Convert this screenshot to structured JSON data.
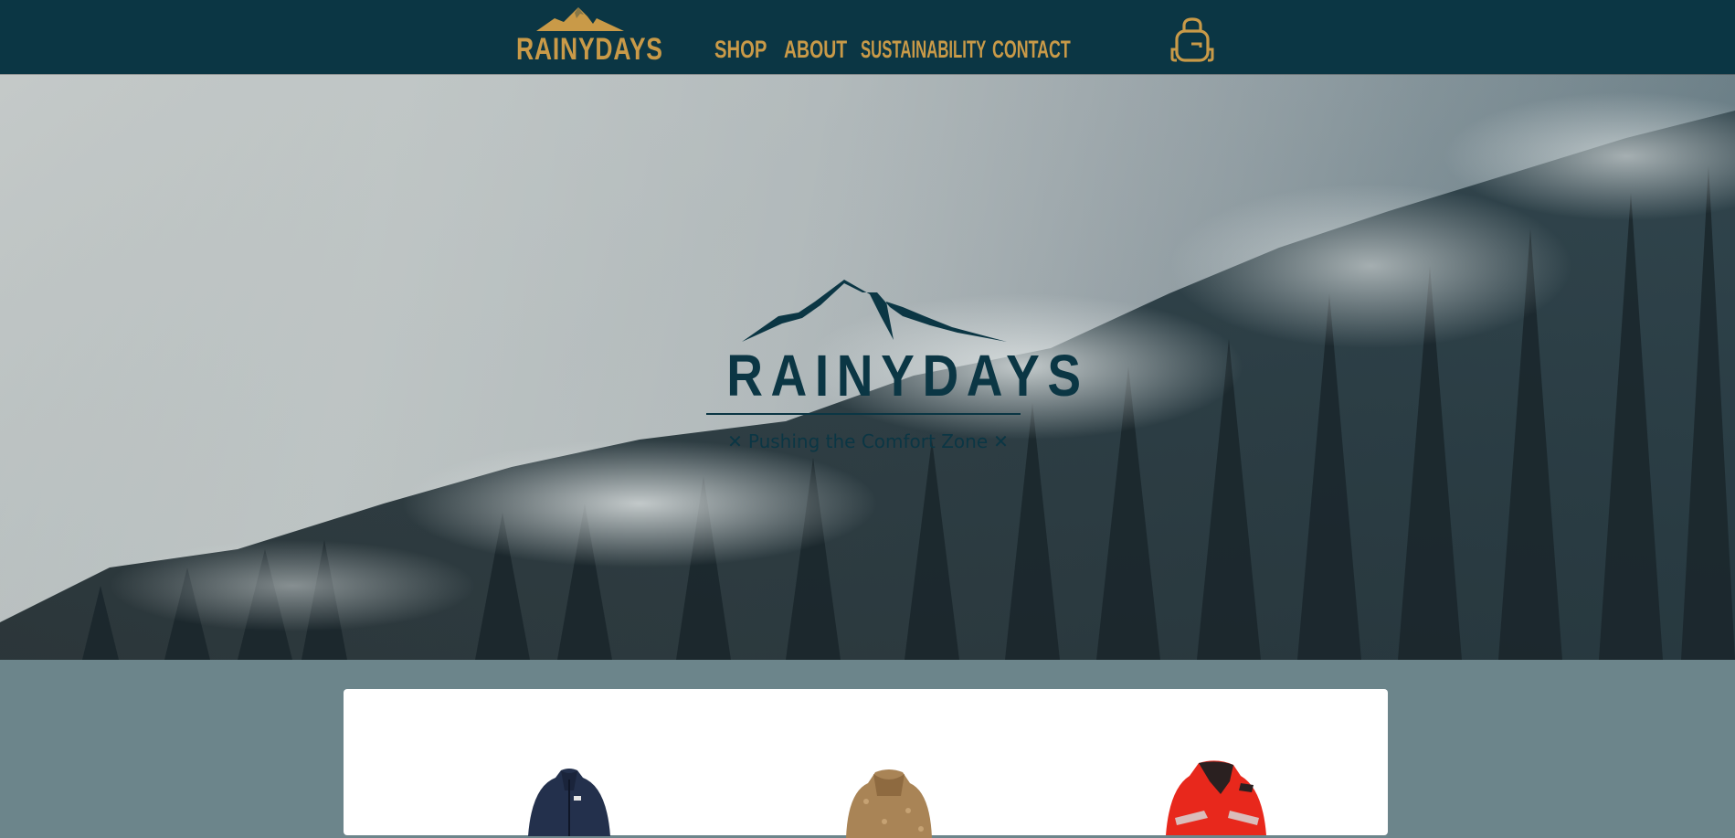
{
  "nav": {
    "logo_text": "RAINYDAYS",
    "links": [
      {
        "label": "SHOP"
      },
      {
        "label": "ABOUT"
      },
      {
        "label": "SUSTAINABILITY"
      },
      {
        "label": "CONTACT"
      }
    ],
    "cart_icon": "backpack-icon"
  },
  "hero": {
    "brand_name": "RAINYDAYS",
    "tagline": "Pushing the Comfort Zone",
    "tagline_icon": "cross-mark-icon"
  },
  "products": [
    {
      "icon": "navy-fleece-jacket-image"
    },
    {
      "icon": "tan-sherpa-jacket-image"
    },
    {
      "icon": "red-rain-jacket-image"
    }
  ],
  "colors": {
    "nav_bg": "#0b3644",
    "accent_gold": "#c99a48",
    "brand_teal": "#0b3644",
    "page_bg": "#6c858b",
    "card_bg": "#ffffff"
  }
}
